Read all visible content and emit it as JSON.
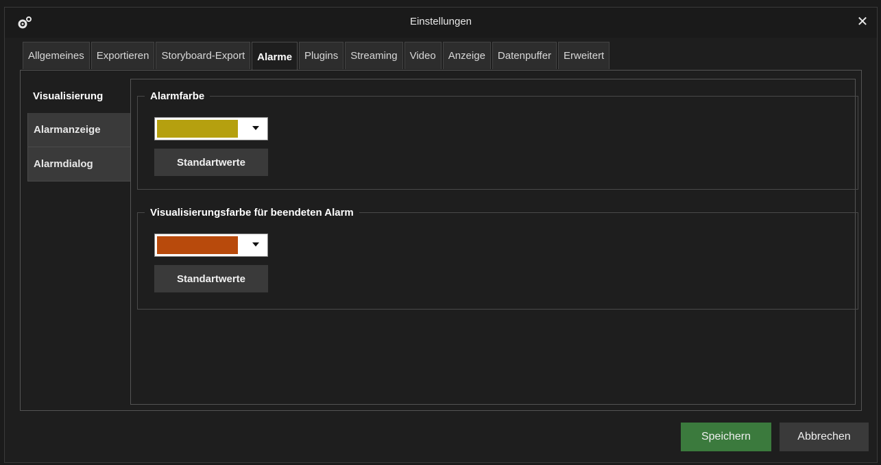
{
  "window": {
    "title": "Einstellungen",
    "close_glyph": "✕",
    "icons": [
      "gear-icon",
      "close-icon"
    ]
  },
  "tabs": [
    {
      "label": "Allgemeines",
      "active": false
    },
    {
      "label": "Exportieren",
      "active": false
    },
    {
      "label": "Storyboard-Export",
      "active": false
    },
    {
      "label": "Alarme",
      "active": true
    },
    {
      "label": "Plugins",
      "active": false
    },
    {
      "label": "Streaming",
      "active": false
    },
    {
      "label": "Video",
      "active": false
    },
    {
      "label": "Anzeige",
      "active": false
    },
    {
      "label": "Datenpuffer",
      "active": false
    },
    {
      "label": "Erweitert",
      "active": false
    }
  ],
  "sidenav": [
    {
      "label": "Visualisierung",
      "active": true
    },
    {
      "label": "Alarmanzeige",
      "active": false
    },
    {
      "label": "Alarmdialog",
      "active": false
    }
  ],
  "groups": {
    "alarm_color": {
      "title": "Alarmfarbe",
      "color": "#b5a00f",
      "defaults_label": "Standartwerte"
    },
    "ended_color": {
      "title": "Visualisierungsfarbe für beendeten Alarm",
      "color": "#b84a0c",
      "defaults_label": "Standartwerte"
    }
  },
  "footer": {
    "save_label": "Speichern",
    "cancel_label": "Abbrechen"
  },
  "colors": {
    "background": "#1e1e1e",
    "save_accent": "#3b7a3d"
  }
}
